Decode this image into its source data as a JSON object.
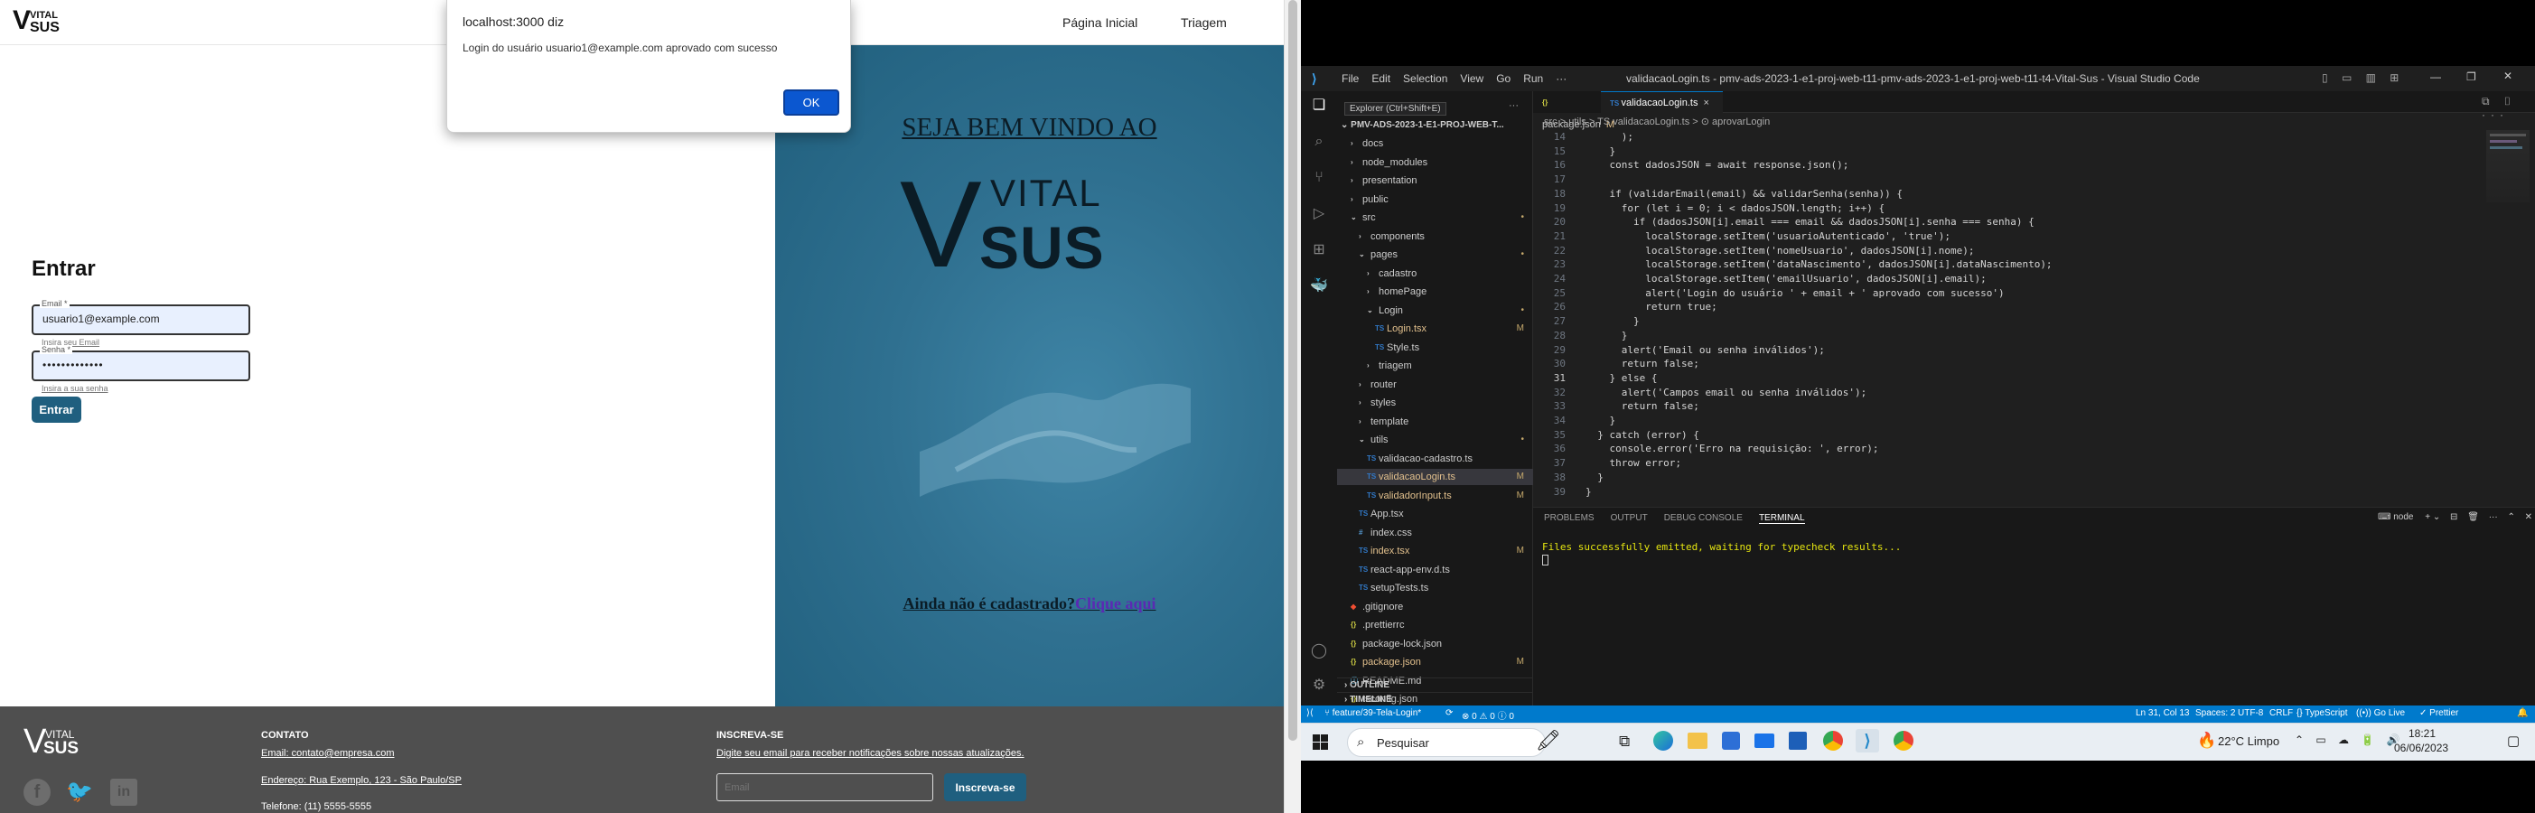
{
  "browser": {
    "nav": {
      "logo_top": "VITAL",
      "logo_bottom": "SUS",
      "home": "Página Inicial",
      "triage": "Triagem"
    },
    "dialog": {
      "origin": "localhost:3000 diz",
      "message": "Login do usuário usuario1@example.com aprovado com sucesso",
      "ok": "OK"
    },
    "login": {
      "title": "Entrar",
      "email_label": "Email *",
      "email_value": "usuario1@example.com",
      "email_helper": "Insira seu Email",
      "password_label": "Senha *",
      "password_value": "•••••••••••••",
      "password_helper": "Insira a sua senha",
      "submit": "Entrar"
    },
    "hero": {
      "welcome": "SEJA BEM VINDO AO",
      "logo_top": "VITAL",
      "logo_bottom": "SUS",
      "not_registered": "Ainda não é cadastrado?",
      "click_here": "Clique aqui"
    },
    "footer": {
      "logo_top": "VITAL",
      "logo_bottom": "SUS",
      "contact_title": "CONTATO",
      "contact_email": "Email: contato@empresa.com",
      "contact_address": "Endereço: Rua Exemplo, 123 - São Paulo/SP",
      "contact_phone": "Telefone: (11) 5555-5555",
      "subscribe_title": "INSCREVA-SE",
      "subscribe_text": "Digite seu email para receber notificações sobre nossas atualizações.",
      "email_placeholder": "Email",
      "subscribe_button": "Inscreva-se"
    }
  },
  "vscode": {
    "menu": [
      "File",
      "Edit",
      "Selection",
      "View",
      "Go",
      "Run",
      "···"
    ],
    "window_title": "validacaoLogin.ts - pmv-ads-2023-1-e1-proj-web-t11-pmv-ads-2023-1-e1-proj-web-t11-t4-Vital-Sus - Visual Studio Code",
    "explorer_tooltip": "Explorer (Ctrl+Shift+E)",
    "project_root": "PMV-ADS-2023-1-E1-PROJ-WEB-T...",
    "tree": [
      {
        "label": "docs",
        "indent": 1,
        "kind": "folder",
        "status": ""
      },
      {
        "label": "node_modules",
        "indent": 1,
        "kind": "folder",
        "status": ""
      },
      {
        "label": "presentation",
        "indent": 1,
        "kind": "folder",
        "status": ""
      },
      {
        "label": "public",
        "indent": 1,
        "kind": "folder",
        "status": ""
      },
      {
        "label": "src",
        "indent": 1,
        "kind": "folder-open",
        "status": "•"
      },
      {
        "label": "components",
        "indent": 2,
        "kind": "folder",
        "status": ""
      },
      {
        "label": "pages",
        "indent": 2,
        "kind": "folder-open",
        "status": "•"
      },
      {
        "label": "cadastro",
        "indent": 3,
        "kind": "folder",
        "status": ""
      },
      {
        "label": "homePage",
        "indent": 3,
        "kind": "folder",
        "status": ""
      },
      {
        "label": "Login",
        "indent": 3,
        "kind": "folder-open",
        "status": "•"
      },
      {
        "label": "Login.tsx",
        "indent": 4,
        "kind": "tsx",
        "status": "M"
      },
      {
        "label": "Style.ts",
        "indent": 4,
        "kind": "ts",
        "status": ""
      },
      {
        "label": "triagem",
        "indent": 3,
        "kind": "folder",
        "status": ""
      },
      {
        "label": "router",
        "indent": 2,
        "kind": "folder",
        "status": ""
      },
      {
        "label": "styles",
        "indent": 2,
        "kind": "folder",
        "status": ""
      },
      {
        "label": "template",
        "indent": 2,
        "kind": "folder",
        "status": ""
      },
      {
        "label": "utils",
        "indent": 2,
        "kind": "folder-open",
        "status": "•"
      },
      {
        "label": "validacao-cadastro.ts",
        "indent": 3,
        "kind": "ts",
        "status": ""
      },
      {
        "label": "validacaoLogin.ts",
        "indent": 3,
        "kind": "ts",
        "status": "M"
      },
      {
        "label": "validadorInput.ts",
        "indent": 3,
        "kind": "ts",
        "status": "M"
      },
      {
        "label": "App.tsx",
        "indent": 2,
        "kind": "tsx",
        "status": ""
      },
      {
        "label": "index.css",
        "indent": 2,
        "kind": "css",
        "status": ""
      },
      {
        "label": "index.tsx",
        "indent": 2,
        "kind": "tsx",
        "status": "M"
      },
      {
        "label": "react-app-env.d.ts",
        "indent": 2,
        "kind": "ts",
        "status": ""
      },
      {
        "label": "setupTests.ts",
        "indent": 2,
        "kind": "ts",
        "status": ""
      },
      {
        "label": ".gitignore",
        "indent": 1,
        "kind": "git",
        "status": ""
      },
      {
        "label": ".prettierrc",
        "indent": 1,
        "kind": "json",
        "status": ""
      },
      {
        "label": "package-lock.json",
        "indent": 1,
        "kind": "json",
        "status": ""
      },
      {
        "label": "package.json",
        "indent": 1,
        "kind": "json",
        "status": "M"
      },
      {
        "label": "README.md",
        "indent": 1,
        "kind": "md",
        "status": ""
      },
      {
        "label": "tsconfig.json",
        "indent": 1,
        "kind": "json",
        "status": ""
      }
    ],
    "outline": "OUTLINE",
    "timeline": "TIMELINE",
    "tabs": [
      {
        "label": "package.json",
        "status": "M",
        "active": false
      },
      {
        "label": "validacaoLogin.ts",
        "status": "×",
        "active": true
      }
    ],
    "breadcrumb": "src > utils > TS validacaoLogin.ts > ⊙ aprovarLogin",
    "code": [
      {
        "n": "14",
        "t": "      );"
      },
      {
        "n": "15",
        "t": "    }"
      },
      {
        "n": "16",
        "t": "    const dadosJSON = await response.json();"
      },
      {
        "n": "17",
        "t": ""
      },
      {
        "n": "18",
        "t": "    if (validarEmail(email) && validarSenha(senha)) {"
      },
      {
        "n": "19",
        "t": "      for (let i = 0; i < dadosJSON.length; i++) {"
      },
      {
        "n": "20",
        "t": "        if (dadosJSON[i].email === email && dadosJSON[i].senha === senha) {"
      },
      {
        "n": "21",
        "t": "          localStorage.setItem('usuarioAutenticado', 'true');"
      },
      {
        "n": "22",
        "t": "          localStorage.setItem('nomeUsuario', dadosJSON[i].nome);"
      },
      {
        "n": "23",
        "t": "          localStorage.setItem('dataNascimento', dadosJSON[i].dataNascimento);"
      },
      {
        "n": "24",
        "t": "          localStorage.setItem('emailUsuario', dadosJSON[i].email);"
      },
      {
        "n": "25",
        "t": "          alert('Login do usuário ' + email + ' aprovado com sucesso')"
      },
      {
        "n": "26",
        "t": "          return true;"
      },
      {
        "n": "27",
        "t": "        }"
      },
      {
        "n": "28",
        "t": "      }"
      },
      {
        "n": "29",
        "t": "      alert('Email ou senha inválidos');"
      },
      {
        "n": "30",
        "t": "      return false;"
      },
      {
        "n": "31",
        "t": "    } else {"
      },
      {
        "n": "32",
        "t": "      alert('Campos email ou senha inválidos');"
      },
      {
        "n": "33",
        "t": "      return false;"
      },
      {
        "n": "34",
        "t": "    }"
      },
      {
        "n": "35",
        "t": "  } catch (error) {"
      },
      {
        "n": "36",
        "t": "    console.error('Erro na requisição: ', error);"
      },
      {
        "n": "37",
        "t": "    throw error;"
      },
      {
        "n": "38",
        "t": "  }"
      },
      {
        "n": "39",
        "t": "}"
      }
    ],
    "panel_tabs": [
      "PROBLEMS",
      "OUTPUT",
      "DEBUG CONSOLE",
      "TERMINAL"
    ],
    "terminal_name": "node",
    "terminal_output": "Files successfully emitted, waiting for typecheck results...",
    "status": {
      "branch": "feature/39-Tela-Login*",
      "sync": "⟳",
      "problems": "⊗ 0  ⚠ 0  ⓘ 0",
      "position": "Ln 31, Col 13",
      "spaces": "Spaces: 2",
      "encoding": "UTF-8",
      "eol": "CRLF",
      "language": "{} TypeScript",
      "golive": "Go Live",
      "prettier": "✓ Prettier"
    },
    "accent": "#007acc"
  },
  "taskbar": {
    "search": "Pesquisar",
    "weather": "22°C  Limpo",
    "time": "18:21",
    "date": "06/06/2023"
  }
}
